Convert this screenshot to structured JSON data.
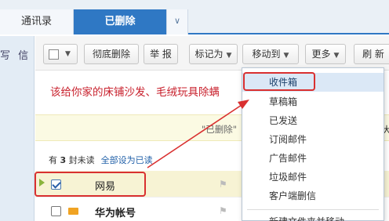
{
  "tabs": [
    {
      "label": "通讯录"
    },
    {
      "label": "已删除"
    }
  ],
  "sidebar": {
    "label": "写 信"
  },
  "toolbar": {
    "permanent_delete": "彻底删除",
    "report": "举 报",
    "mark_as": "标记为",
    "move_to": "移动到",
    "more": "更多",
    "refresh": "刷 新"
  },
  "ad_text": "该给你家的床铺沙发、毛绒玩具除螨",
  "notice_text": "\"已删除\"",
  "unread": {
    "prefix": "有 ",
    "count": "3",
    "suffix": " 封未读",
    "mark_all": "全部设为已读"
  },
  "mails": [
    {
      "sender": "网易",
      "checked": true,
      "selected": true
    },
    {
      "sender": "华为帐号",
      "checked": false,
      "selected": false
    }
  ],
  "move_menu": {
    "items": [
      "收件箱",
      "草稿箱",
      "已发送",
      "订阅邮件",
      "广告邮件",
      "垃圾邮件",
      "客户端删信"
    ],
    "footer_partial": "新建文件夹并移动"
  },
  "colors": {
    "tab_active": "#2f78c4",
    "highlight": "#d93030",
    "ad_red": "#c8202c"
  },
  "icons": [
    "checkbox-icon",
    "chevron-down-icon",
    "flag-icon",
    "envelope-icon",
    "row-marker-icon",
    "arrow-annotation-icon"
  ]
}
